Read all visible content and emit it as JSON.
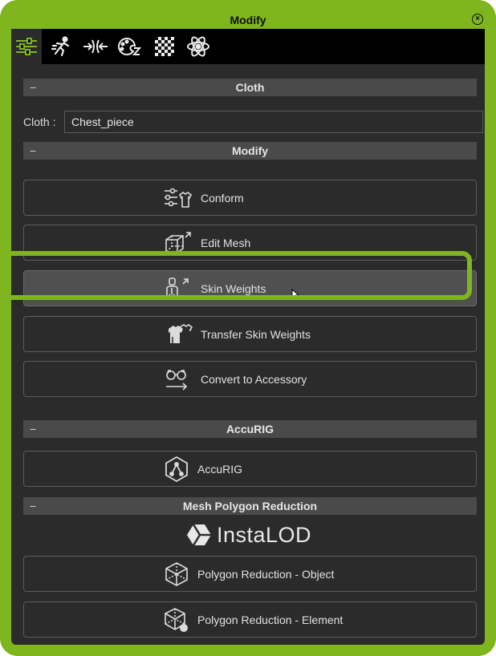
{
  "window": {
    "title": "Modify"
  },
  "tabs": [
    {
      "icon": "sliders-icon",
      "active": true
    },
    {
      "icon": "motion-icon",
      "active": false
    },
    {
      "icon": "morph-icon",
      "active": false
    },
    {
      "icon": "material-icon",
      "active": false
    },
    {
      "icon": "texture-checker-icon",
      "active": false
    },
    {
      "icon": "physics-atom-icon",
      "active": false
    }
  ],
  "cloth_section": {
    "title": "Cloth",
    "field_label": "Cloth :",
    "field_value": "Chest_piece"
  },
  "modify_section": {
    "title": "Modify",
    "buttons": [
      {
        "label": "Conform",
        "icon": "conform-icon"
      },
      {
        "label": "Edit Mesh",
        "icon": "edit-mesh-icon"
      },
      {
        "label": "Skin Weights",
        "icon": "skin-weights-icon",
        "selected": true
      },
      {
        "label": "Transfer Skin Weights",
        "icon": "transfer-skin-weights-icon"
      },
      {
        "label": "Convert to Accessory",
        "icon": "convert-accessory-icon"
      }
    ]
  },
  "accurig_section": {
    "title": "AccuRIG",
    "button_label": "AccuRIG"
  },
  "reduction_section": {
    "title": "Mesh Polygon Reduction",
    "logo_text": "InstaLOD",
    "buttons": [
      {
        "label": "Polygon Reduction - Object",
        "icon": "polygon-object-icon"
      },
      {
        "label": "Polygon Reduction - Element",
        "icon": "polygon-element-icon"
      }
    ]
  },
  "colors": {
    "accent": "#7fb51f",
    "panel": "#2b2b2b",
    "section": "#4a4a4a",
    "selected": "#505050"
  }
}
